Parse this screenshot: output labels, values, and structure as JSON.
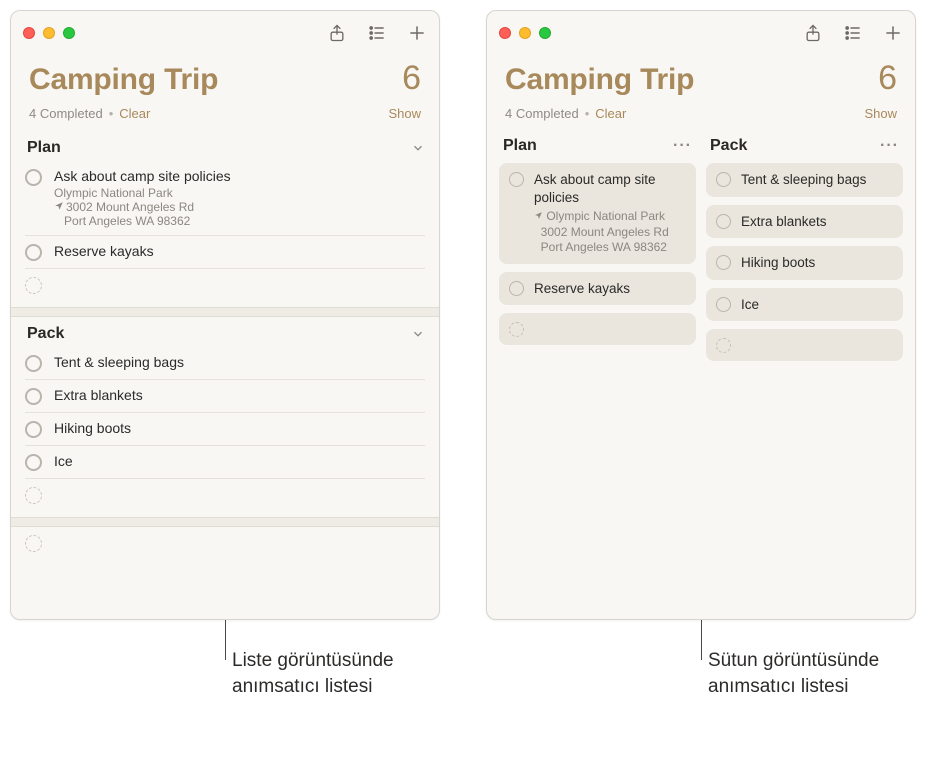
{
  "title": "Camping Trip",
  "count": "6",
  "completed_text": "4 Completed",
  "clear_label": "Clear",
  "show_label": "Show",
  "sections": {
    "plan": {
      "heading": "Plan",
      "items": [
        {
          "title": "Ask about camp site policies",
          "sub_name": "Olympic National Park",
          "sub_addr1": "3002 Mount Angeles Rd",
          "sub_addr2": "Port Angeles WA 98362"
        },
        {
          "title": "Reserve kayaks"
        }
      ]
    },
    "pack": {
      "heading": "Pack",
      "items": [
        {
          "title": "Tent & sleeping bags"
        },
        {
          "title": "Extra blankets"
        },
        {
          "title": "Hiking boots"
        },
        {
          "title": "Ice"
        }
      ]
    }
  },
  "callouts": {
    "list": "Liste görüntüsünde anımsatıcı listesi",
    "column": "Sütun görüntüsünde anımsatıcı listesi"
  }
}
